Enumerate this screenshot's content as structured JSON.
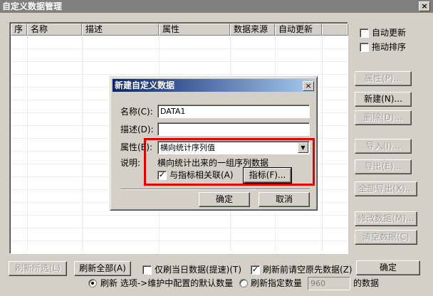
{
  "window": {
    "title": "自定义数据管理",
    "close_label": "×"
  },
  "table": {
    "columns": [
      "序",
      "名称",
      "描述",
      "属性",
      "数据来源",
      "自动更新"
    ]
  },
  "options": {
    "auto_update": {
      "label": "自动更新",
      "checked": false
    },
    "drag_sort": {
      "label": "拖动排序",
      "checked": false
    }
  },
  "side_buttons": {
    "properties": "属性(P)...",
    "new": "新建(N)...",
    "delete": "删除(D)...",
    "import": "导入(I)...",
    "export": "导出(E)...",
    "export_all": "全部导出(X)...",
    "modify_data": "修改数据(M)...",
    "clear_data": "清空数据(C)"
  },
  "bottom": {
    "refresh_selected": "刷新所选(L)",
    "refresh_all": "刷新全部(A)",
    "today_only": {
      "label": "仅刷当日数据(提速)(T)",
      "checked": false
    },
    "clear_before": {
      "label": "刷新前请空原先数据(Z)",
      "checked": true
    },
    "ok": "确定",
    "radio_default_label": "刷新 选项->维护中配置的默认数量",
    "radio_custom_label": "刷新指定数量",
    "custom_count": "960",
    "data_suffix": "的数据"
  },
  "dialog": {
    "title": "新建自定义数据",
    "close_label": "×",
    "name_label": "名称(C):",
    "name_value": "DATA1",
    "desc_label": "描述(D):",
    "desc_value": "",
    "attr_label": "属性(E):",
    "attr_value": "横向统计序列值",
    "note_label": "说明:",
    "note_text": "横向统计出来的一组序列数据",
    "link_indicator": {
      "label": "与指标相关联(A)",
      "checked": true
    },
    "indicator_button": "指标(F)...",
    "ok": "确定",
    "cancel": "取消"
  }
}
